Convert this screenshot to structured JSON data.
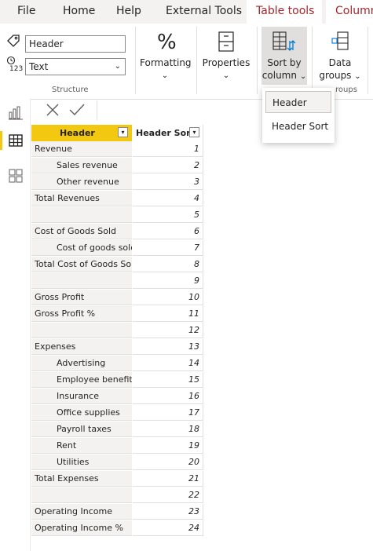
{
  "menu": {
    "tabs": [
      {
        "label": "File",
        "active": false,
        "contextual": false
      },
      {
        "label": "Home",
        "active": false,
        "contextual": false
      },
      {
        "label": "Help",
        "active": false,
        "contextual": false
      },
      {
        "label": "External Tools",
        "active": false,
        "contextual": false
      },
      {
        "label": "Table tools",
        "active": true,
        "contextual": true
      },
      {
        "label": "Column tools",
        "active": true,
        "contextual": true
      }
    ]
  },
  "ribbon": {
    "structure": {
      "name_value": "Header",
      "data_type_value": "Text",
      "group_label": "Structure"
    },
    "formatting_label": "Formatting",
    "properties_label": "Properties",
    "sort_by_column": {
      "label_line1": "Sort by",
      "label_line2": "column"
    },
    "data_groups": {
      "label_line1": "Data",
      "label_line2": "groups"
    },
    "groups_group_label_partial": "roups"
  },
  "sort_dropdown": {
    "items": [
      "Header",
      "Header Sort"
    ],
    "selected": "Header"
  },
  "colors": {
    "accent_yellow": "#f2c811",
    "column_selected_header": "#f2c811",
    "contextual_tab": "#a4262c",
    "row_label_bg": "#f3f2f1"
  },
  "table": {
    "columns": [
      "Header",
      "Header Sort"
    ],
    "rows": [
      {
        "header": "Revenue",
        "indent": false,
        "sort": "1"
      },
      {
        "header": "Sales revenue",
        "indent": true,
        "sort": "2"
      },
      {
        "header": "Other revenue",
        "indent": true,
        "sort": "3"
      },
      {
        "header": "Total Revenues",
        "indent": false,
        "sort": "4"
      },
      {
        "header": "",
        "indent": false,
        "sort": "5"
      },
      {
        "header": "Cost of Goods Sold",
        "indent": false,
        "sort": "6"
      },
      {
        "header": "Cost of goods sold",
        "indent": true,
        "sort": "7"
      },
      {
        "header": "Total Cost of Goods Sold",
        "indent": false,
        "sort": "8"
      },
      {
        "header": "",
        "indent": false,
        "sort": "9"
      },
      {
        "header": "Gross Profit",
        "indent": false,
        "sort": "10"
      },
      {
        "header": "Gross Profit %",
        "indent": false,
        "sort": "11"
      },
      {
        "header": "",
        "indent": false,
        "sort": "12"
      },
      {
        "header": "Expenses",
        "indent": false,
        "sort": "13"
      },
      {
        "header": "Advertising",
        "indent": true,
        "sort": "14"
      },
      {
        "header": "Employee benefits",
        "indent": true,
        "sort": "15"
      },
      {
        "header": "Insurance",
        "indent": true,
        "sort": "16"
      },
      {
        "header": "Office supplies",
        "indent": true,
        "sort": "17"
      },
      {
        "header": "Payroll taxes",
        "indent": true,
        "sort": "18"
      },
      {
        "header": "Rent",
        "indent": true,
        "sort": "19"
      },
      {
        "header": "Utilities",
        "indent": true,
        "sort": "20"
      },
      {
        "header": "Total Expenses",
        "indent": false,
        "sort": "21"
      },
      {
        "header": "",
        "indent": false,
        "sort": "22"
      },
      {
        "header": "Operating Income",
        "indent": false,
        "sort": "23"
      },
      {
        "header": "Operating Income %",
        "indent": false,
        "sort": "24"
      }
    ]
  }
}
